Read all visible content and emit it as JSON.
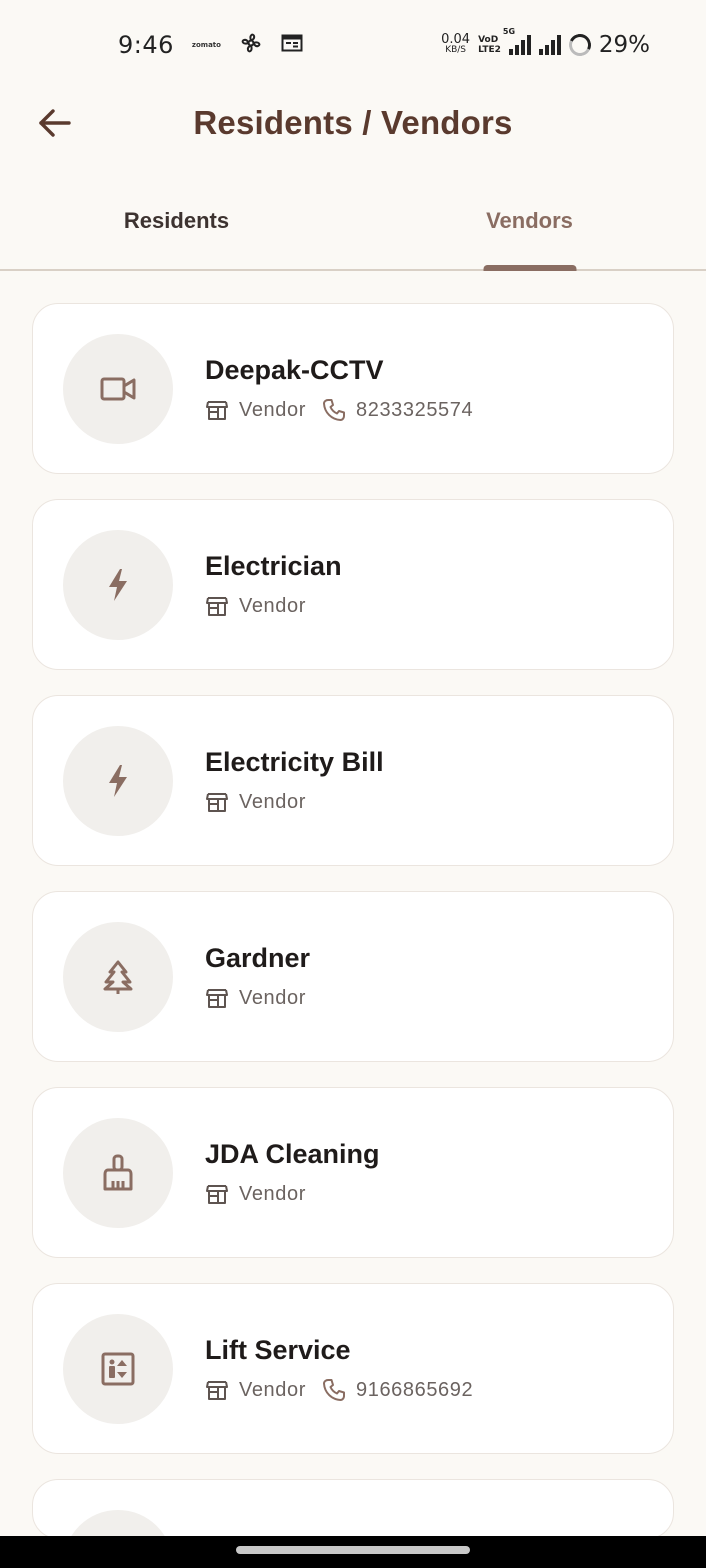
{
  "status_bar": {
    "time": "9:46",
    "notif_app": "zomato",
    "net_speed_value": "0.04",
    "net_speed_unit": "KB/S",
    "volte_top": "VoD",
    "volte_bottom": "LTE2",
    "network_tag": "5G",
    "battery": "29%"
  },
  "header": {
    "title": "Residents / Vendors"
  },
  "tabs": [
    {
      "label": "Residents",
      "active": false
    },
    {
      "label": "Vendors",
      "active": true
    }
  ],
  "vendors": [
    {
      "name": "Deepak-CCTV",
      "type": "Vendor",
      "phone": "8233325574",
      "icon": "video-camera-icon"
    },
    {
      "name": "Electrician",
      "type": "Vendor",
      "phone": "",
      "icon": "lightning-icon"
    },
    {
      "name": "Electricity Bill",
      "type": "Vendor",
      "phone": "",
      "icon": "lightning-icon"
    },
    {
      "name": "Gardner",
      "type": "Vendor",
      "phone": "",
      "icon": "tree-icon"
    },
    {
      "name": "JDA Cleaning",
      "type": "Vendor",
      "phone": "",
      "icon": "broom-icon"
    },
    {
      "name": "Lift Service",
      "type": "Vendor",
      "phone": "9166865692",
      "icon": "elevator-icon"
    }
  ],
  "colors": {
    "accent": "#8a6d62",
    "title": "#5a3a2e",
    "background": "#fbf9f5",
    "card": "#ffffff",
    "avatar_bg": "#f1efec"
  }
}
